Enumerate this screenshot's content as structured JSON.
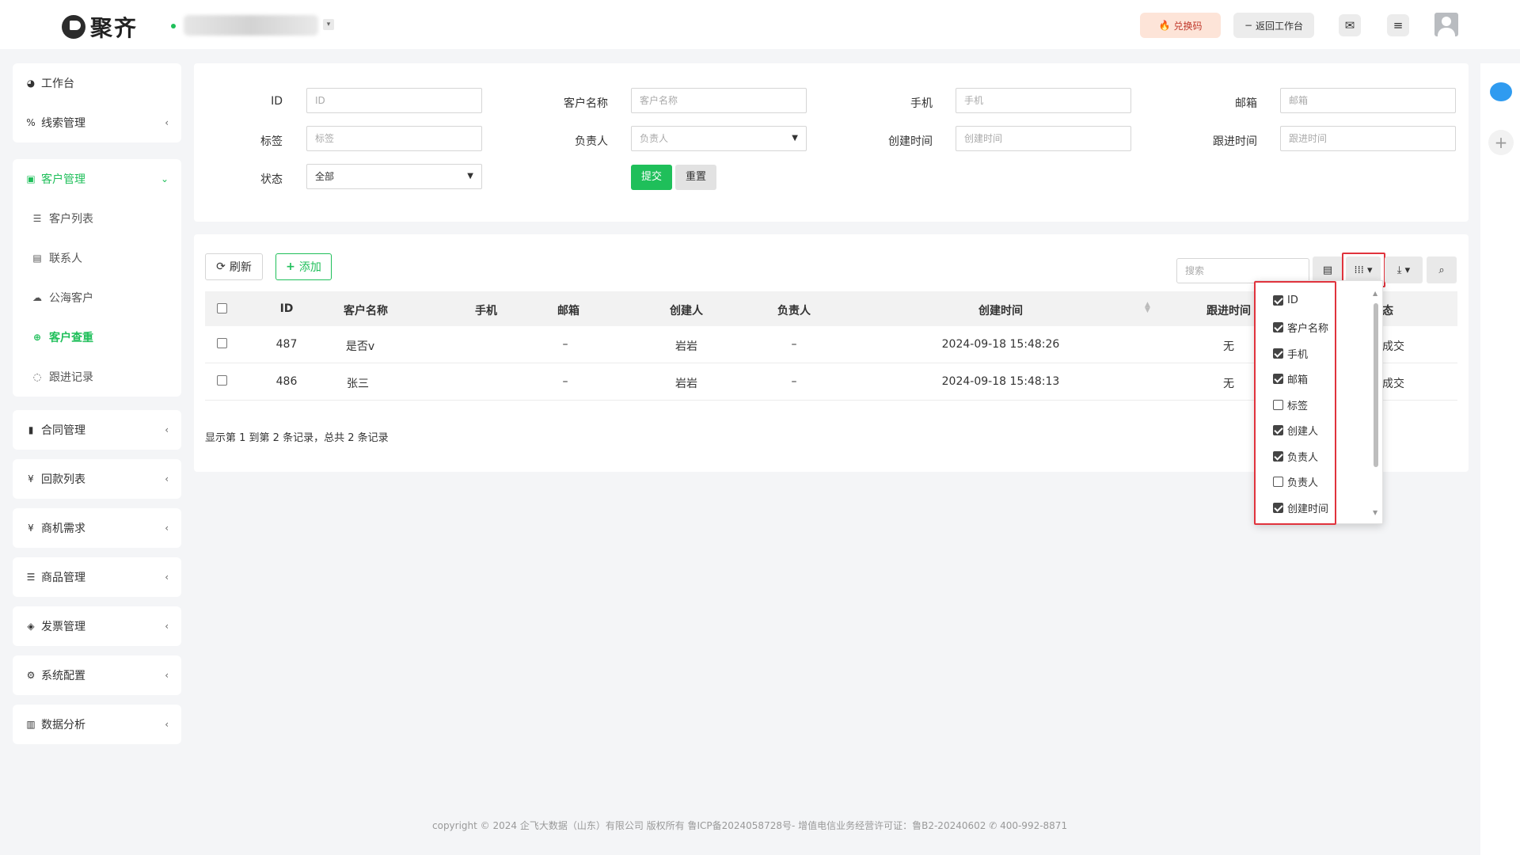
{
  "header": {
    "brand": "聚齐",
    "redeem_label": "兑换码",
    "back_label": "返回工作台"
  },
  "sidebar": {
    "top": [
      {
        "label": "工作台",
        "icon": "dashboard-icon"
      },
      {
        "label": "线索管理",
        "icon": "link-icon"
      }
    ],
    "customer": {
      "label": "客户管理",
      "children": [
        {
          "label": "客户列表",
          "icon": "list-icon"
        },
        {
          "label": "联系人",
          "icon": "contact-card-icon"
        },
        {
          "label": "公海客户",
          "icon": "cloud-icon"
        },
        {
          "label": "客户查重",
          "icon": "search-plus-icon"
        },
        {
          "label": "跟进记录",
          "icon": "chat-icon"
        }
      ]
    },
    "groups": [
      {
        "label": "合同管理",
        "icon": "bookmark-icon"
      },
      {
        "label": "回款列表",
        "icon": "yen-icon"
      },
      {
        "label": "商机需求",
        "icon": "yen-icon"
      },
      {
        "label": "商品管理",
        "icon": "list-icon"
      },
      {
        "label": "发票管理",
        "icon": "tag-icon"
      },
      {
        "label": "系统配置",
        "icon": "gears-icon"
      },
      {
        "label": "数据分析",
        "icon": "bar-chart-icon"
      }
    ]
  },
  "filters": {
    "id": {
      "label": "ID",
      "placeholder": "ID"
    },
    "name": {
      "label": "客户名称",
      "placeholder": "客户名称"
    },
    "phone": {
      "label": "手机",
      "placeholder": "手机"
    },
    "email": {
      "label": "邮箱",
      "placeholder": "邮箱"
    },
    "tag": {
      "label": "标签",
      "placeholder": "标签"
    },
    "owner": {
      "label": "负责人",
      "placeholder": "负责人"
    },
    "created": {
      "label": "创建时间",
      "placeholder": "创建时间"
    },
    "followup": {
      "label": "跟进时间",
      "placeholder": "跟进时间"
    },
    "status": {
      "label": "状态",
      "value": "全部"
    },
    "submit_label": "提交",
    "reset_label": "重置"
  },
  "toolbar": {
    "refresh_label": "刷新",
    "add_label": "添加",
    "search_placeholder": "搜索"
  },
  "table": {
    "columns": [
      "ID",
      "客户名称",
      "手机",
      "邮箱",
      "创建人",
      "负责人",
      "创建时间",
      "跟进时间",
      "态"
    ],
    "rows": [
      {
        "id": "487",
        "name": "是否v",
        "phone": "",
        "email": "–",
        "creator": "岩岩",
        "owner": "–",
        "created": "2024-09-18 15:48:26",
        "followup": "无",
        "status": "成交"
      },
      {
        "id": "486",
        "name": "张三",
        "phone": "",
        "email": "–",
        "creator": "岩岩",
        "owner": "–",
        "created": "2024-09-18 15:48:13",
        "followup": "无",
        "status": "成交"
      }
    ],
    "summary": "显示第 1 到第 2 条记录，总共 2 条记录"
  },
  "column_menu": {
    "items": [
      {
        "label": "ID",
        "checked": true
      },
      {
        "label": "客户名称",
        "checked": true
      },
      {
        "label": "手机",
        "checked": true
      },
      {
        "label": "邮箱",
        "checked": true
      },
      {
        "label": "标签",
        "checked": false
      },
      {
        "label": "创建人",
        "checked": true
      },
      {
        "label": "负责人",
        "checked": true
      },
      {
        "label": "负责人",
        "checked": false
      },
      {
        "label": "创建时间",
        "checked": true
      }
    ]
  },
  "footer": {
    "text": "copyright © 2024 企飞大数据（山东）有限公司 版权所有   鲁ICP备2024058728号-   增值电信业务经营许可证：鲁B2-20240602 ✆ 400-992-8871"
  },
  "colors": {
    "accent": "#1fbf5a",
    "highlight": "#e0333d"
  }
}
